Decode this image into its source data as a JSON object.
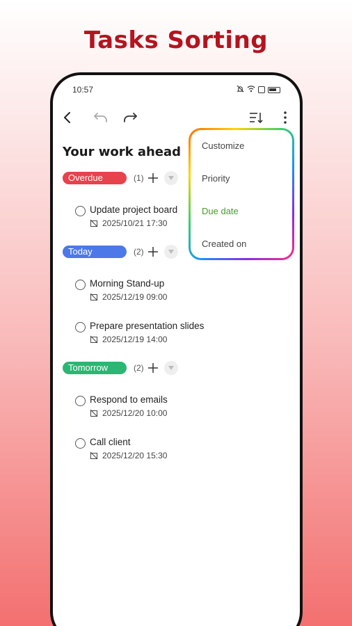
{
  "promo": {
    "title": "Tasks Sorting"
  },
  "status_bar": {
    "time": "10:57"
  },
  "toolbar": {
    "back_icon": "back-arrow-icon",
    "undo_icon": "undo-icon",
    "redo_icon": "redo-icon",
    "sort_icon": "sort-icon",
    "more_icon": "more-vertical-icon"
  },
  "page": {
    "title": "Your work ahead"
  },
  "groups": [
    {
      "label": "Overdue",
      "count": "(1)",
      "color": "#e8424c",
      "tasks": [
        {
          "title": "Update project board",
          "date": "2025/10/21 17:30"
        }
      ]
    },
    {
      "label": "Today",
      "count": "(2)",
      "color": "#4c78e8",
      "tasks": [
        {
          "title": "Morning Stand-up",
          "date": "2025/12/19 09:00"
        },
        {
          "title": "Prepare presentation slides",
          "date": "2025/12/19 14:00"
        }
      ]
    },
    {
      "label": "Tomorrow",
      "count": "(2)",
      "color": "#2bb673",
      "tasks": [
        {
          "title": "Respond to emails",
          "date": "2025/12/20 10:00"
        },
        {
          "title": "Call client",
          "date": "2025/12/20 15:30"
        }
      ]
    }
  ],
  "sort_menu": {
    "items": [
      "Customize",
      "Priority",
      "Due date",
      "Created on"
    ],
    "selected_index": 2,
    "selected_color": "#4a9a2a"
  }
}
